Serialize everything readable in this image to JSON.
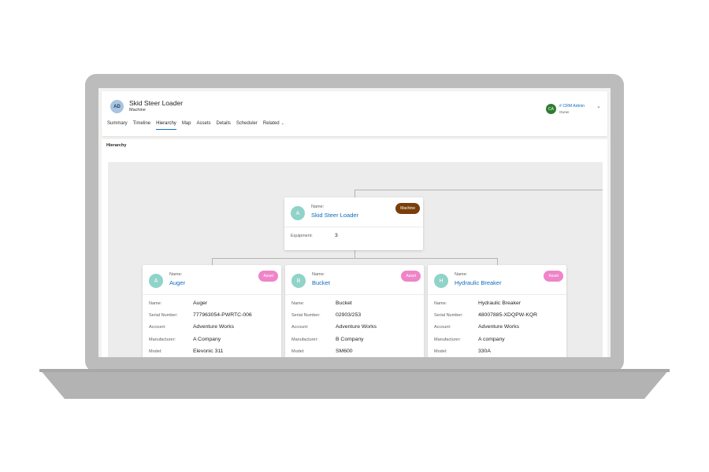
{
  "record": {
    "initials": "AD",
    "title": "Skid Steer Loader",
    "subtitle": "Machine"
  },
  "tabs": [
    {
      "label": "Summary"
    },
    {
      "label": "Timeline"
    },
    {
      "label": "Hierarchy"
    },
    {
      "label": "Map"
    },
    {
      "label": "Assets"
    },
    {
      "label": "Details"
    },
    {
      "label": "Scheduler"
    },
    {
      "label": "Related"
    }
  ],
  "owner": {
    "initials": "CA",
    "name": "# CRM Admin",
    "role": "Owner"
  },
  "panel": {
    "title": "Hierarchy"
  },
  "root": {
    "initials": "A",
    "name_label": "Name:",
    "name": "Skid Steer Loader",
    "tag": "Machine",
    "equipment_label": "Equipment:",
    "equipment_count": "3"
  },
  "field_labels": {
    "name": "Name:",
    "serial": "Serial Number:",
    "account": "Account:",
    "manufacturer": "Manufacturer:",
    "model": "Model:"
  },
  "children": [
    {
      "initials": "A",
      "name_label": "Name:",
      "name": "Auger",
      "tag": "Asset",
      "fields": {
        "name": "Auger",
        "serial": "777963054-PWRTC-006",
        "account": "Adventure Works",
        "manufacturer": "A Company",
        "model": "Elevonic 311"
      }
    },
    {
      "initials": "B",
      "name_label": "Name:",
      "name": "Bucket",
      "tag": "Asset",
      "fields": {
        "name": "Bucket",
        "serial": "02903/253",
        "account": "Adventure Works",
        "manufacturer": "B Company",
        "model": "SM600"
      }
    },
    {
      "initials": "H",
      "name_label": "Name:",
      "name": "Hydraulic Breaker",
      "tag": "Asset",
      "fields": {
        "name": "Hydraulic Breaker",
        "serial": "48007885-XDQPW-KQR",
        "account": "Adventure Works",
        "manufacturer": "A company",
        "model": "330A"
      }
    }
  ],
  "colors": {
    "accent": "#0f6cbd",
    "machine_tag": "#7a3e0a",
    "asset_tag": "#ef85c8",
    "avatar_teal": "#8fd3c9"
  }
}
